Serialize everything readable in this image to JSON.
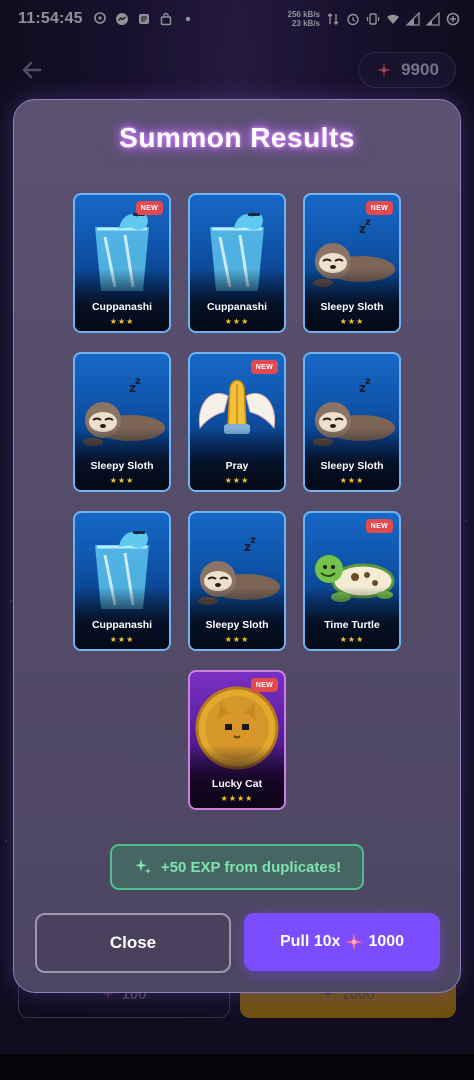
{
  "status_bar": {
    "time": "11:54:45",
    "net_speed_up": "256 kB/s",
    "net_speed_down": "23 kB/s",
    "left_icons": [
      "location-icon",
      "messenger-icon",
      "notes-icon",
      "shop-bag-icon",
      "dot-icon"
    ],
    "right_icons": [
      "data-arrows-icon",
      "alarm-icon",
      "vibrate-icon",
      "wifi-icon",
      "signal-icon",
      "signal-icon",
      "battery-saver-icon"
    ]
  },
  "top_nav": {
    "back_icon": "arrow-left-icon",
    "currency_icon": "sparkle-icon",
    "currency_amount": "9900"
  },
  "background_buttons": {
    "single_pull_cost": "100",
    "multi_pull_cost": "1000"
  },
  "modal": {
    "title": "Summon Results",
    "cards": [
      {
        "name": "Cuppanashi",
        "stars": "★★★",
        "new": true,
        "art": "cup-icon",
        "rarity": "rare"
      },
      {
        "name": "Cuppanashi",
        "stars": "★★★",
        "new": false,
        "art": "cup-icon",
        "rarity": "rare"
      },
      {
        "name": "Sleepy Sloth",
        "stars": "★★★",
        "new": true,
        "art": "sloth-icon",
        "rarity": "rare"
      },
      {
        "name": "Sleepy Sloth",
        "stars": "★★★",
        "new": false,
        "art": "sloth-icon",
        "rarity": "rare"
      },
      {
        "name": "Pray",
        "stars": "★★★",
        "new": true,
        "art": "praying-hands-icon",
        "rarity": "rare"
      },
      {
        "name": "Sleepy Sloth",
        "stars": "★★★",
        "new": false,
        "art": "sloth-icon",
        "rarity": "rare"
      },
      {
        "name": "Cuppanashi",
        "stars": "★★★",
        "new": false,
        "art": "cup-icon",
        "rarity": "rare"
      },
      {
        "name": "Sleepy Sloth",
        "stars": "★★★",
        "new": false,
        "art": "sloth-icon",
        "rarity": "rare"
      },
      {
        "name": "Time Turtle",
        "stars": "★★★",
        "new": true,
        "art": "turtle-icon",
        "rarity": "rare"
      },
      {
        "name": "Lucky Cat",
        "stars": "★★★★",
        "new": true,
        "art": "lucky-cat-coin-icon",
        "rarity": "legendary"
      }
    ],
    "new_badge_label": "NEW",
    "exp_banner": {
      "icon": "sparkles-icon",
      "text": "+50 EXP from duplicates!"
    },
    "close_label": "Close",
    "pull_label": "Pull 10x",
    "pull_cost": "1000",
    "pull_cost_icon": "sparkle-icon"
  },
  "colors": {
    "accent_purple": "#7b4dff",
    "card_blue": "#1768c7",
    "card_legendary": "#7a2fc4",
    "new_badge": "#e24a4f",
    "exp_green": "#4fbf88",
    "star_gold": "#f4c430"
  }
}
